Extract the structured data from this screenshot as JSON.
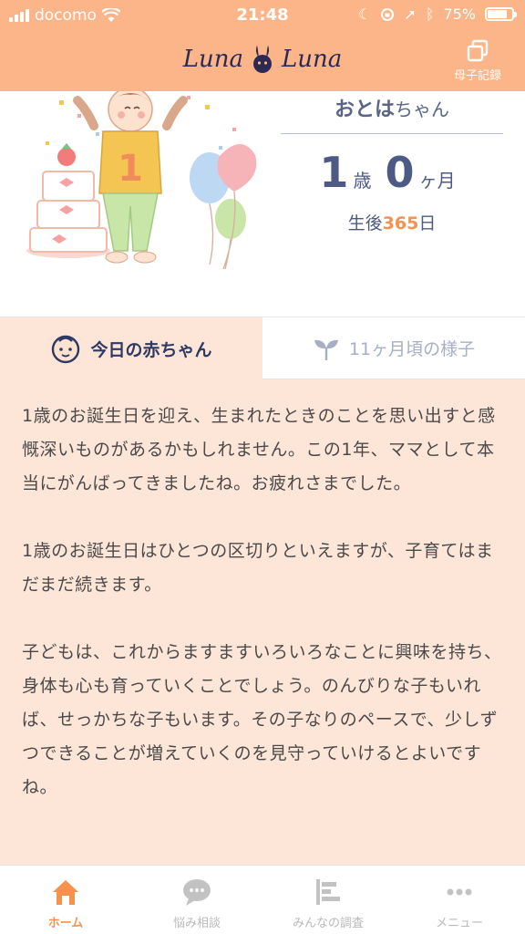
{
  "status_bar": {
    "carrier": "docomo",
    "time": "21:48",
    "battery": "75%",
    "battery_level": 0.75
  },
  "header": {
    "logo": "Luna",
    "logo_right": "Luna",
    "record_button": "母子記録"
  },
  "profile": {
    "name": "おとは",
    "name_suffix": "ちゃん",
    "age_years": "1",
    "age_years_unit": "歳",
    "age_months": "0",
    "age_months_unit": "ヶ月",
    "days_prefix": "生後",
    "days": "365",
    "days_suffix": "日"
  },
  "tabs": [
    {
      "label": "今日の赤ちゃん",
      "active": true
    },
    {
      "label": "11ヶ月頃の様子",
      "active": false
    }
  ],
  "content": {
    "paragraphs": [
      "1歳のお誕生日を迎え、生まれたときのことを思い出すと感慨深いものがあるかもしれません。この1年、ママとして本当にがんばってきましたね。お疲れさまでした。",
      "1歳のお誕生日はひとつの区切りといえますが、子育てはまだまだ続きます。",
      "子どもは、これからますますいろいろなことに興味を持ち、身体も心も育っていくことでしょう。のんびりな子もいれば、せっかちな子もいます。その子なりのペースで、少しずつできることが増えていくのを見守っていけるとよいですね。"
    ]
  },
  "bottom_nav": [
    {
      "label": "ホーム",
      "icon": "home-icon",
      "active": true
    },
    {
      "label": "悩み相談",
      "icon": "chat-icon",
      "active": false
    },
    {
      "label": "みんなの調査",
      "icon": "survey-icon",
      "active": false
    },
    {
      "label": "メニュー",
      "icon": "menu-dots-icon",
      "active": false
    }
  ],
  "colors": {
    "header": "#fbb588",
    "content_bg": "#fde5d8",
    "accent": "#f6914e",
    "navy": "#2e3a66"
  }
}
